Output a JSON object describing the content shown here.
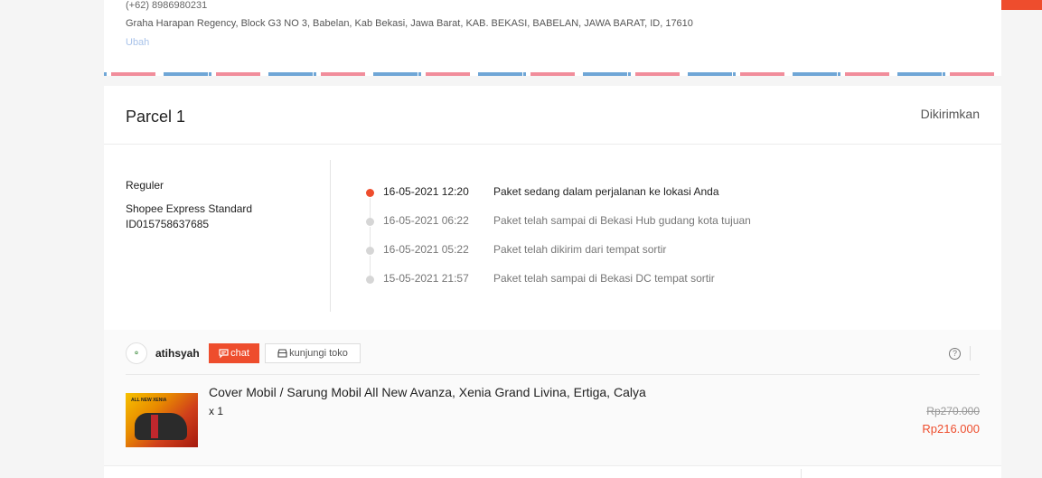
{
  "address": {
    "phone": "(+62) 8986980231",
    "line": "Graha Harapan Regency, Block G3 NO 3, Babelan, Kab Bekasi, Jawa Barat, KAB. BEKASI, BABELAN, JAWA BARAT, ID, 17610",
    "change_label": "Ubah"
  },
  "parcel": {
    "title": "Parcel 1",
    "status": "Dikirimkan",
    "service_type": "Reguler",
    "courier": "Shopee Express Standard",
    "tracking_id": "ID015758637685",
    "timeline": [
      {
        "time": "16-05-2021 12:20",
        "desc": "Paket sedang dalam perjalanan ke lokasi Anda"
      },
      {
        "time": "16-05-2021 06:22",
        "desc": "Paket telah sampai di Bekasi Hub gudang kota tujuan"
      },
      {
        "time": "16-05-2021 05:22",
        "desc": "Paket telah dikirim dari tempat sortir"
      },
      {
        "time": "15-05-2021 21:57",
        "desc": "Paket telah sampai di Bekasi DC tempat sortir"
      }
    ]
  },
  "shop": {
    "name": "atihsyah",
    "chat_label": "chat",
    "visit_label": "kunjungi toko"
  },
  "product": {
    "name": "Cover Mobil / Sarung Mobil All New Avanza, Xenia Grand Livina, Ertiga, Calya",
    "qty": "x 1",
    "price_original": "Rp270.000",
    "price_final": "Rp216.000",
    "image_text": "ALL NEW XENIA"
  },
  "colors": {
    "accent": "#ee4d2d",
    "link": "#a9c3ea"
  }
}
